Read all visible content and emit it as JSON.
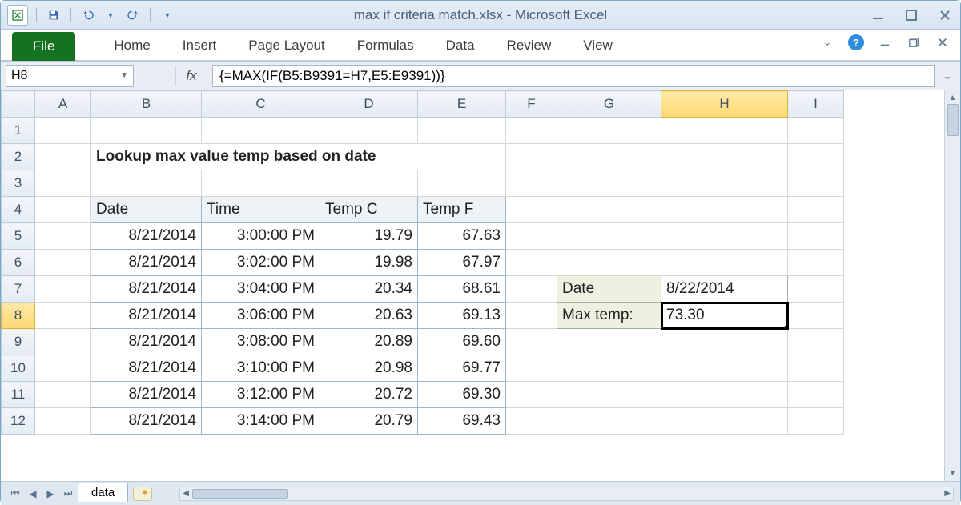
{
  "app": {
    "title": "max if criteria match.xlsx - Microsoft Excel"
  },
  "ribbon": {
    "file": "File",
    "tabs": [
      "Home",
      "Insert",
      "Page Layout",
      "Formulas",
      "Data",
      "Review",
      "View"
    ]
  },
  "name_box": "H8",
  "fx_label": "fx",
  "formula": "{=MAX(IF(B5:B9391=H7,E5:E9391))}",
  "columns": [
    "A",
    "B",
    "C",
    "D",
    "E",
    "F",
    "G",
    "H",
    "I"
  ],
  "row_numbers": [
    "1",
    "2",
    "3",
    "4",
    "5",
    "6",
    "7",
    "8",
    "9",
    "10",
    "11",
    "12"
  ],
  "sheet_title": "Lookup max value temp based on date",
  "table": {
    "headers": {
      "date": "Date",
      "time": "Time",
      "tempc": "Temp C",
      "tempf": "Temp F"
    },
    "rows": [
      {
        "date": "8/21/2014",
        "time": "3:00:00 PM",
        "c": "19.79",
        "f": "67.63"
      },
      {
        "date": "8/21/2014",
        "time": "3:02:00 PM",
        "c": "19.98",
        "f": "67.97"
      },
      {
        "date": "8/21/2014",
        "time": "3:04:00 PM",
        "c": "20.34",
        "f": "68.61"
      },
      {
        "date": "8/21/2014",
        "time": "3:06:00 PM",
        "c": "20.63",
        "f": "69.13"
      },
      {
        "date": "8/21/2014",
        "time": "3:08:00 PM",
        "c": "20.89",
        "f": "69.60"
      },
      {
        "date": "8/21/2014",
        "time": "3:10:00 PM",
        "c": "20.98",
        "f": "69.77"
      },
      {
        "date": "8/21/2014",
        "time": "3:12:00 PM",
        "c": "20.72",
        "f": "69.30"
      },
      {
        "date": "8/21/2014",
        "time": "3:14:00 PM",
        "c": "20.79",
        "f": "69.43"
      }
    ]
  },
  "side": {
    "date_label": "Date",
    "date_value": "8/22/2014",
    "max_label": "Max temp:",
    "max_value": "73.30"
  },
  "sheet_tab": "data"
}
